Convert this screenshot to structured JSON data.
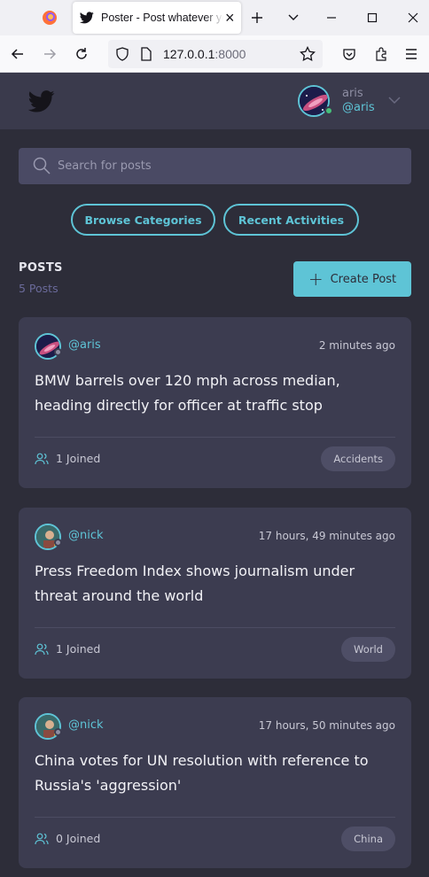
{
  "browser": {
    "tab_title": "Poster - Post whatever you want",
    "url_host": "127.0.0.1",
    "url_port": ":8000"
  },
  "header": {
    "user_name": "aris",
    "user_handle": "@aris"
  },
  "search": {
    "placeholder": "Search for posts"
  },
  "buttons": {
    "browse_categories": "Browse Categories",
    "recent_activities": "Recent Activities",
    "create_post": "Create Post"
  },
  "posts_section": {
    "label": "POSTS",
    "count": "5 Posts"
  },
  "posts": [
    {
      "handle": "@aris",
      "time": "2 minutes ago",
      "title": "BMW barrels over 120 mph across median, heading directly for officer at traffic stop",
      "joined": "1 Joined",
      "category": "Accidents"
    },
    {
      "handle": "@nick",
      "time": "17 hours, 49 minutes ago",
      "title": "Press Freedom Index shows journalism under threat around the world",
      "joined": "1 Joined",
      "category": "World"
    },
    {
      "handle": "@nick",
      "time": "17 hours, 50 minutes ago",
      "title": "China votes for UN resolution with reference to Russia's 'aggression'",
      "joined": "0 Joined",
      "category": "China"
    }
  ],
  "colors": {
    "accent": "#5ec4d6",
    "background": "#2d2d39",
    "card": "#3c3c50",
    "header": "#3a3a4c"
  }
}
